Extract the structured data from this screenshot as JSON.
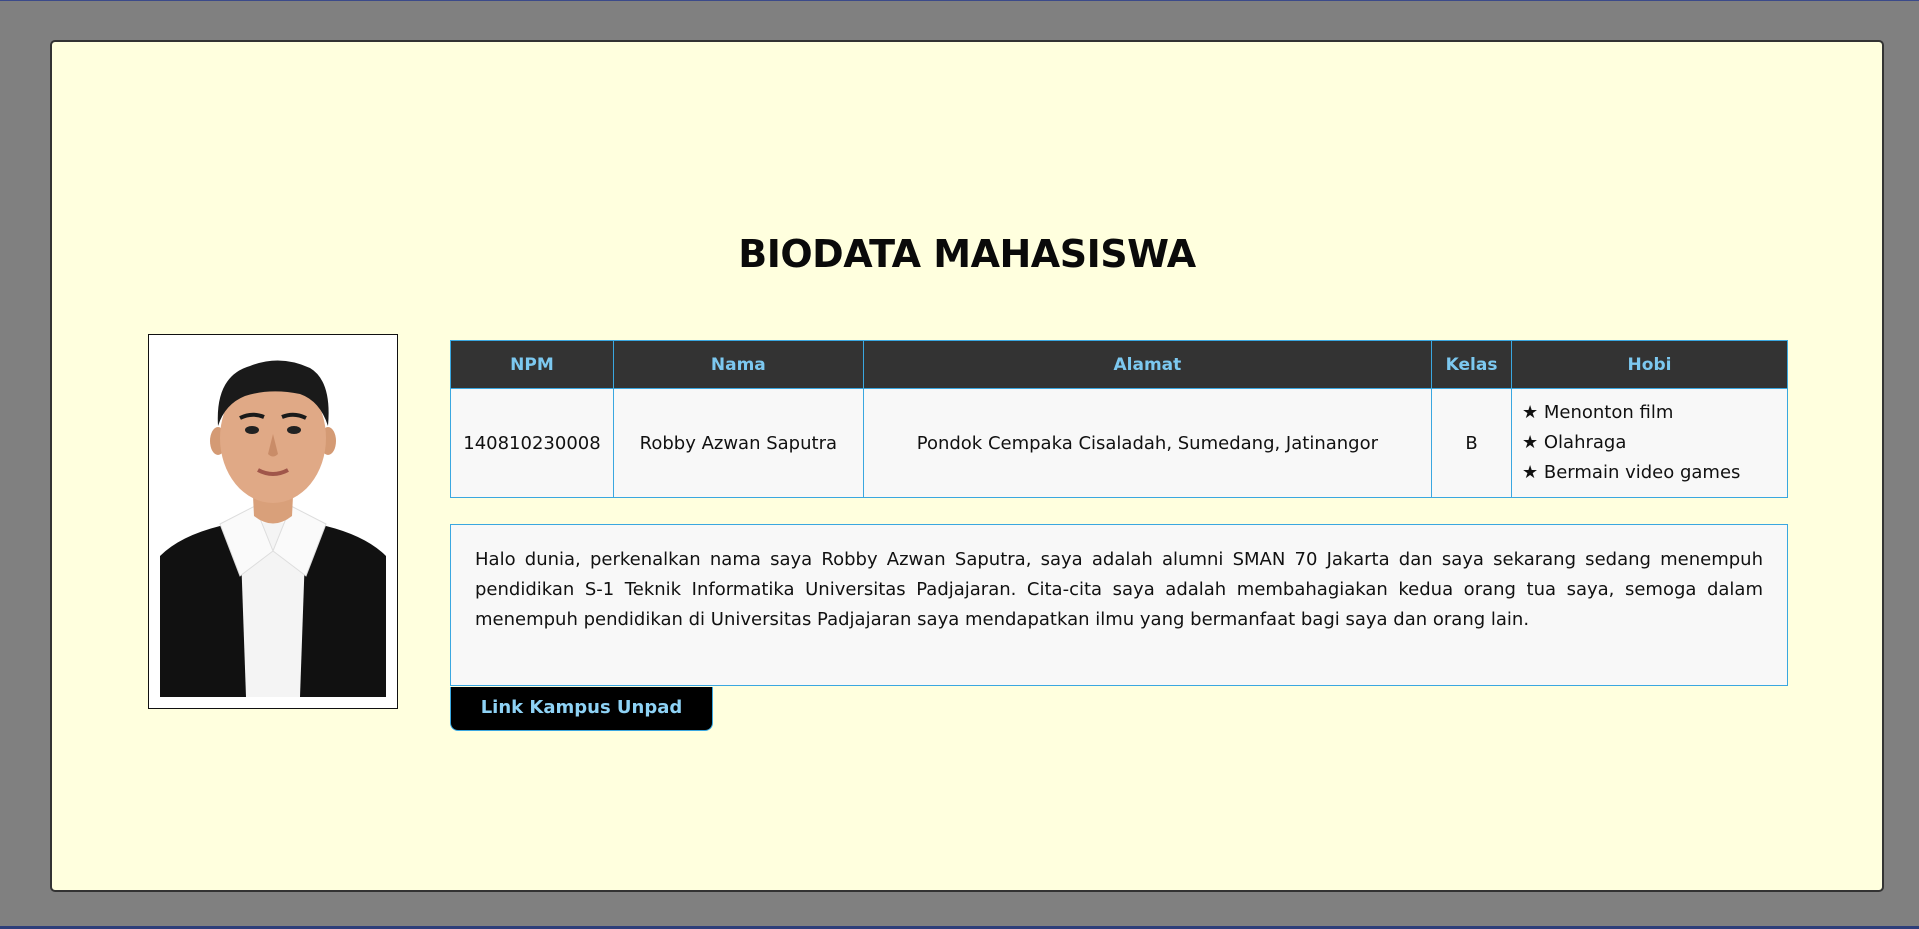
{
  "page": {
    "title": "BIODATA MAHASISWA"
  },
  "table": {
    "headers": {
      "npm": "NPM",
      "nama": "Nama",
      "alamat": "Alamat",
      "kelas": "Kelas",
      "hobi": "Hobi"
    },
    "row": {
      "npm": "140810230008",
      "nama": "Robby Azwan Saputra",
      "alamat": "Pondok Cempaka Cisaladah, Sumedang, Jatinangor",
      "kelas": "B",
      "hobi": [
        "★ Menonton film",
        "★ Olahraga",
        "★ Bermain video games"
      ]
    }
  },
  "description": "Halo dunia, perkenalkan nama saya Robby Azwan Saputra, saya adalah alumni SMAN 70 Jakarta dan saya sekarang sedang menempuh pendidikan S-1 Teknik Informatika Universitas Padjajaran. Cita-cita saya adalah membahagiakan kedua orang tua saya, semoga dalam menempuh pendidikan di Universitas Padjajaran saya mendapatkan ilmu yang bermanfaat bagi saya dan orang lain.",
  "link": {
    "label": "Link Kampus Unpad"
  },
  "colors": {
    "page_bg": "#808080",
    "card_bg": "#ffffde",
    "header_bg": "#333333",
    "header_text": "#7cc8f0",
    "border_accent": "#3aa7e0"
  },
  "icons": {
    "hobby_bullet": "star-icon",
    "photo": "student-portrait"
  }
}
